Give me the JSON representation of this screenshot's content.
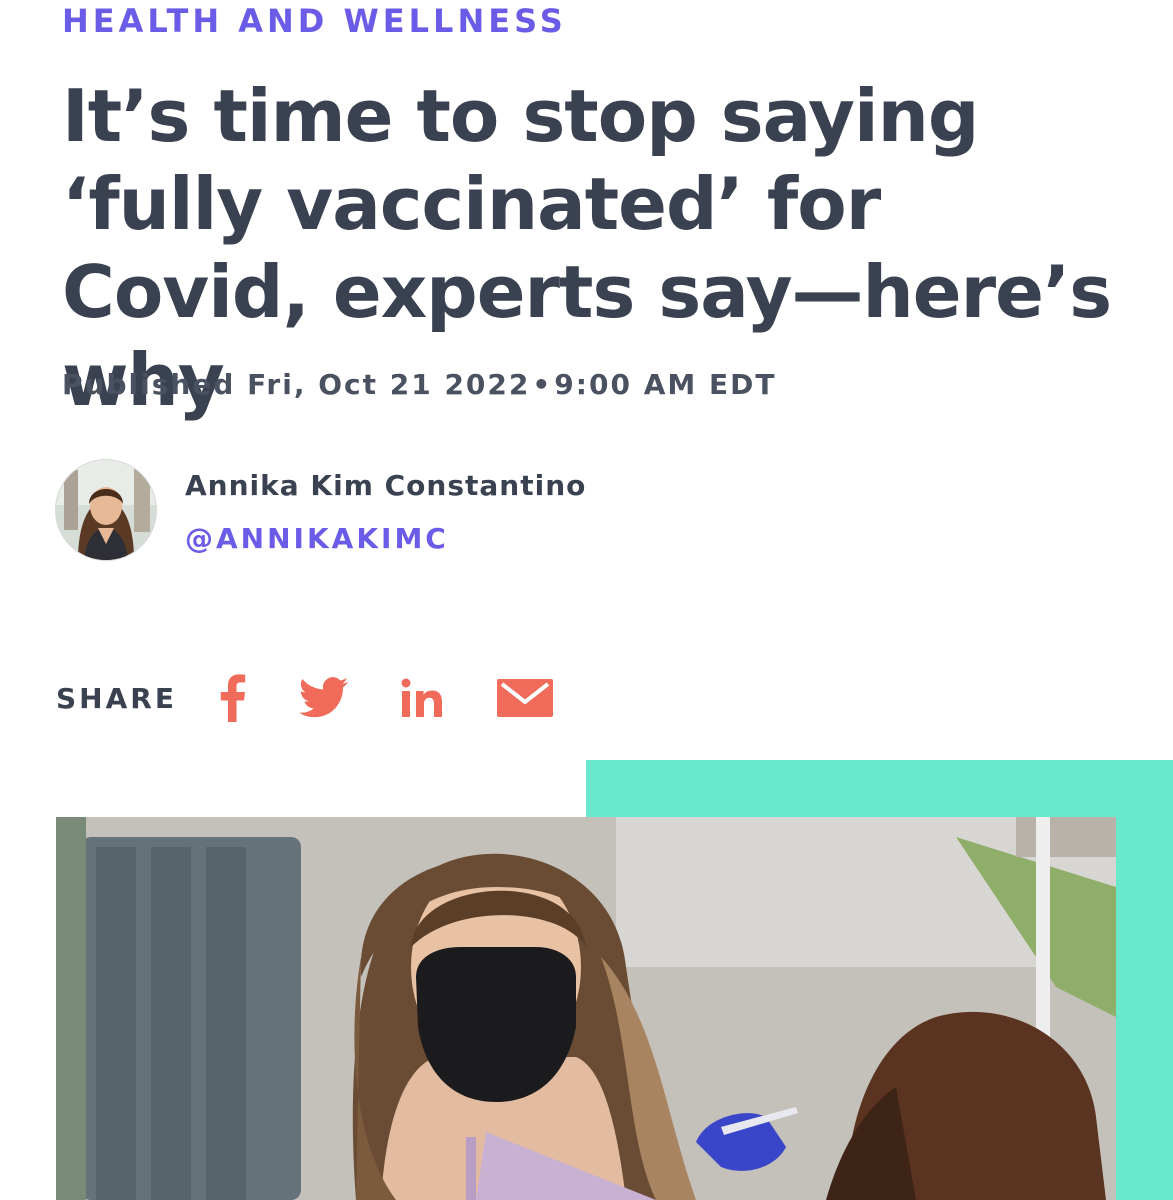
{
  "article": {
    "category": "HEALTH AND WELLNESS",
    "headline": "It’s time to stop saying ‘fully vaccinated’ for Covid, experts say—here’s why",
    "published_prefix": "Published",
    "published_date": "Fri, Oct 21 2022",
    "published_separator": "•",
    "published_time": "9:00 AM EDT"
  },
  "author": {
    "name": "Annika Kim Constantino",
    "handle": "@ANNIKAKIMC"
  },
  "share": {
    "label": "SHARE",
    "icons": [
      "facebook-icon",
      "twitter-icon",
      "linkedin-icon",
      "email-icon"
    ]
  },
  "colors": {
    "accent_purple": "#6b5ce7",
    "heading_text": "#3a4150",
    "share_icon": "#f06b5a",
    "accent_block": "#69e8cc"
  }
}
